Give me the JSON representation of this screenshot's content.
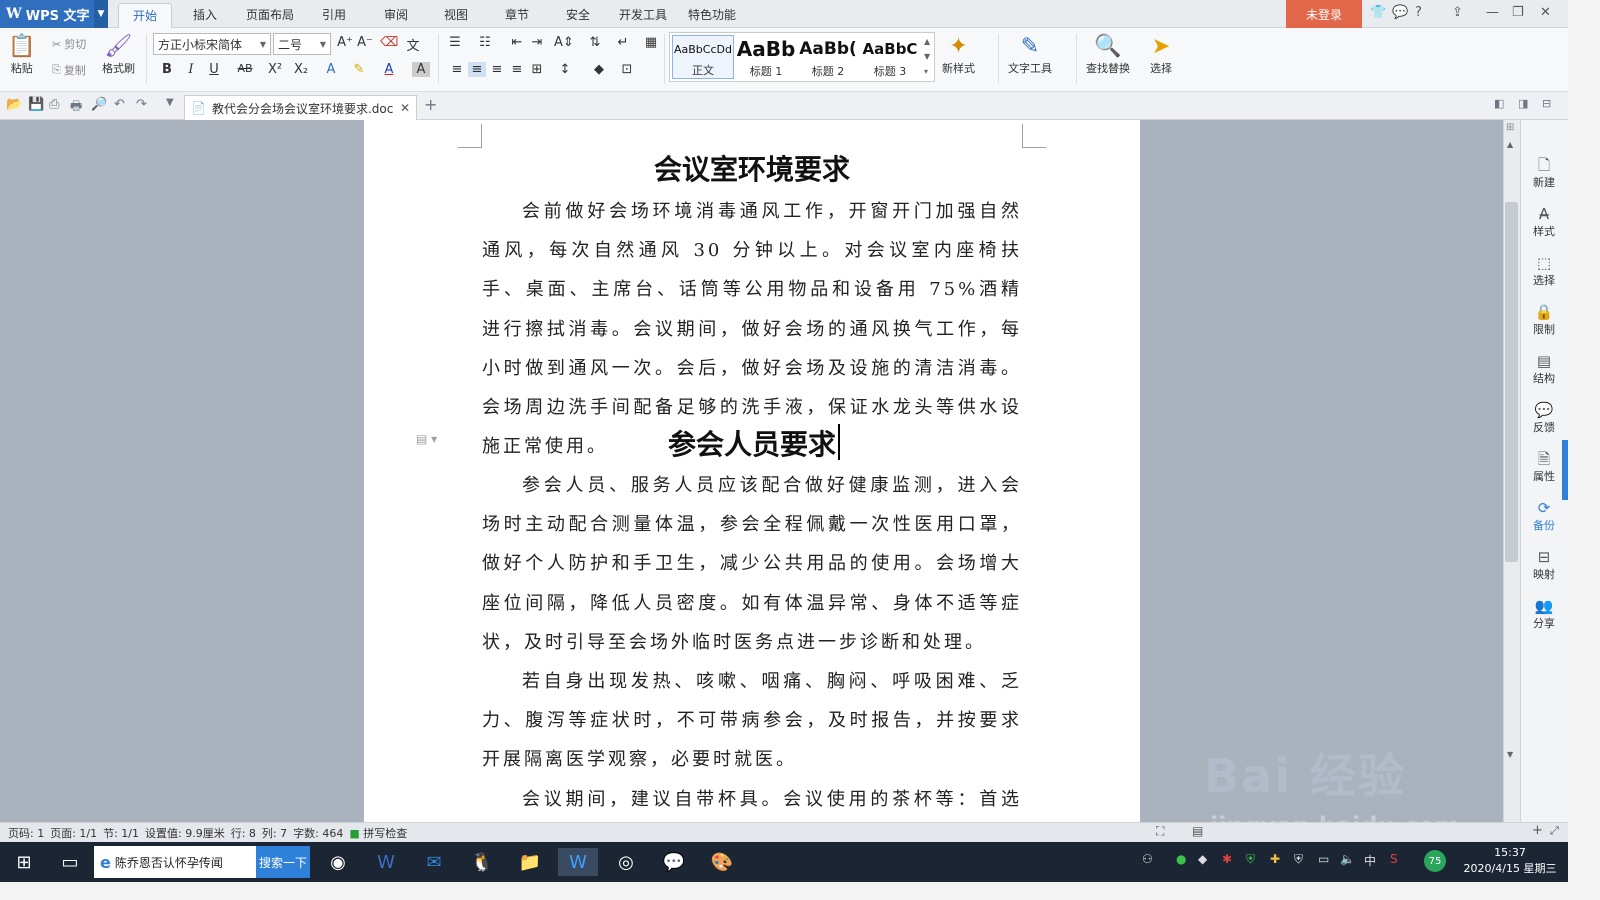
{
  "app": {
    "name": "WPS 文字",
    "login": "未登录"
  },
  "ribbon_tabs": [
    {
      "label": "开始",
      "active": true
    },
    {
      "label": "插入"
    },
    {
      "label": "页面布局"
    },
    {
      "label": "引用"
    },
    {
      "label": "审阅"
    },
    {
      "label": "视图"
    },
    {
      "label": "章节"
    },
    {
      "label": "安全"
    },
    {
      "label": "开发工具"
    },
    {
      "label": "特色功能"
    }
  ],
  "ribbon": {
    "paste": "粘贴",
    "cut": "剪切",
    "copy": "复制",
    "format_painter": "格式刷",
    "font_name": "方正小标宋简体",
    "font_size": "二号",
    "styles": [
      {
        "preview": "AaBbCcDd",
        "name": "正文"
      },
      {
        "preview": "AaBb",
        "name": "标题 1"
      },
      {
        "preview": "AaBb(",
        "name": "标题 2"
      },
      {
        "preview": "AaBbC",
        "name": "标题 3"
      }
    ],
    "new_style": "新样式",
    "text_tools": "文字工具",
    "find_replace": "查找替换",
    "select": "选择"
  },
  "doc_tab": {
    "filename": "教代会分会场会议室环境要求.docx"
  },
  "document": {
    "heading1": "会议室环境要求",
    "para1": "会前做好会场环境消毒通风工作，开窗开门加强自然通风，每次自然通风 30 分钟以上。对会议室内座椅扶手、桌面、主席台、话筒等公用物品和设备用 75%酒精进行擦拭消毒。会议期间，做好会场的通风换气工作，每小时做到通风一次。会后，做好会场及设施的清洁消毒。会场周边洗手间配备足够的洗手液，保证水龙头等供水设施正常使用。",
    "heading2": "参会人员要求",
    "para2": "参会人员、服务人员应该配合做好健康监测，进入会场时主动配合测量体温，参会全程佩戴一次性医用口罩，做好个人防护和手卫生，减少公共用品的使用。会场增大座位间隔，降低人员密度。如有体温异常、身体不适等症状，及时引导至会场外临时医务点进一步诊断和处理。",
    "para3": "若自身出现发热、咳嗽、咽痛、胸闷、呼吸困难、乏力、腹泻等症状时，不可带病参会，及时报告，并按要求开展隔离医学观察，必要时就医。",
    "para4": "会议期间，建议自带杯具。会议使用的茶杯等：首选瓶"
  },
  "sidebar": [
    {
      "label": "新建"
    },
    {
      "label": "样式"
    },
    {
      "label": "选择"
    },
    {
      "label": "限制"
    },
    {
      "label": "结构"
    },
    {
      "label": "反馈"
    },
    {
      "label": "属性"
    },
    {
      "label": "备份",
      "active": true
    },
    {
      "label": "映射"
    },
    {
      "label": "分享"
    }
  ],
  "status": {
    "page_code": "页码: 1",
    "page": "页面: 1/1",
    "section": "节: 1/1",
    "setting": "设置值: 9.9厘米",
    "row": "行: 8",
    "col": "列: 7",
    "words": "字数: 464",
    "spell": "拼写检查"
  },
  "taskbar": {
    "search_text": "陈乔恩否认怀孕传闻",
    "search_button": "搜索一下",
    "time": "15:37",
    "date": "2020/4/15 星期三",
    "ime": "中",
    "badge": "75"
  },
  "watermark": {
    "text": "Bai 经验",
    "url": "jingyan.baidu.com"
  },
  "colors": {
    "accent": "#2f6fbd",
    "login": "#e2674a",
    "taskbar": "#1c2533"
  }
}
